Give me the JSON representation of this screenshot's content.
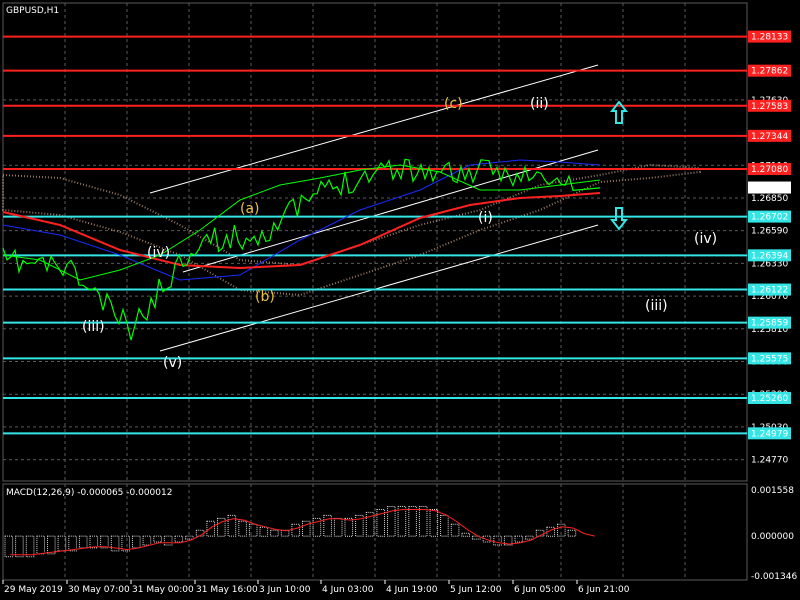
{
  "symbol": "GBPUSD,H1",
  "colors": {
    "background": "#000000",
    "grid": "#5a5a5a",
    "price_line": "#00ff00",
    "ma_red": "#ff2020",
    "ma_blue": "#1a2cff",
    "ma_green": "#00ff00",
    "resistance": "#ff2020",
    "support": "#34e5e5",
    "channel": "#ffffff",
    "cloud": "#d8a98c",
    "macd_hist": "#d8d8d8",
    "macd_signal": "#ff2020",
    "wave_white": "#ffffff",
    "wave_yellow": "#e8c040",
    "arrow": "#34e5e5"
  },
  "resistance_levels": [
    "1.28133",
    "1.27862",
    "1.27583",
    "1.27344",
    "1.27080"
  ],
  "support_levels": [
    "1.26702",
    "1.26394",
    "1.26122",
    "1.25859",
    "1.25575",
    "1.25260",
    "1.24979"
  ],
  "price_axis_ticks": [
    "1.27630",
    "1.27110",
    "1.26850",
    "1.26590",
    "1.26330",
    "1.26070",
    "1.25810",
    "1.25550",
    "1.25290",
    "1.25030",
    "1.24770"
  ],
  "current_price": "1.26933",
  "time_axis_labels": [
    "29 May 2019",
    "30 May 07:00",
    "31 May 00:00",
    "31 May 16:00",
    "3 Jun 10:00",
    "4 Jun 03:00",
    "4 Jun 19:00",
    "5 Jun 12:00",
    "6 Jun 05:00",
    "6 Jun 21:00"
  ],
  "wave_labels": {
    "c": "(c)",
    "ii_top": "(ii)",
    "a": "(a)",
    "b": "(b)",
    "iv_left": "(iv)",
    "v": "(v)",
    "iii_left": "(iii)",
    "i": "(i)",
    "iv_right": "(iv)",
    "iii_right": "(iii)"
  },
  "macd": {
    "title": "MACD(12,26,9) -0.000065 -0.000012",
    "axis_ticks": [
      "0.001558",
      "0.000000",
      "-0.001346"
    ]
  },
  "chart_data": [
    {
      "type": "line",
      "title": "GBPUSD,H1",
      "xlabel": "",
      "ylabel": "",
      "ylim": [
        1.246,
        1.284
      ],
      "x": [
        "29 May 2019",
        "30 May 07:00",
        "31 May 00:00",
        "31 May 16:00",
        "3 Jun 10:00",
        "4 Jun 03:00",
        "4 Jun 19:00",
        "5 Jun 12:00",
        "6 Jun 05:00",
        "6 Jun 21:00"
      ],
      "series": [
        {
          "values": [
            1.2635,
            1.263,
            1.258,
            1.265,
            1.2655,
            1.269,
            1.271,
            1.2705,
            1.2705,
            1.2693
          ]
        }
      ],
      "horizontal_lines": [
        1.28133,
        1.27862,
        1.27583,
        1.27344,
        1.2708,
        1.26702,
        1.26394,
        1.26122,
        1.25859,
        1.25575,
        1.2526,
        1.24979
      ],
      "grid": true,
      "legend": "none"
    },
    {
      "type": "bar",
      "title": "MACD(12,26,9) -0.000065 -0.000012",
      "ylim": [
        -0.001346,
        0.001558
      ],
      "values": [
        -0.0007,
        -0.0007,
        -0.0007,
        -0.0006,
        -0.0006,
        -0.0005,
        -0.0005,
        -0.0004,
        -0.0004,
        -0.0004,
        -0.0005,
        -0.0005,
        -0.0004,
        -0.0003,
        -0.0002,
        -0.0003,
        -0.0002,
        -0.0001,
        0.0002,
        0.0005,
        0.0006,
        0.0007,
        0.0005,
        0.0004,
        0.0003,
        0.0002,
        0.0002,
        0.0004,
        0.0005,
        0.0006,
        0.0007,
        0.0006,
        0.0006,
        0.0007,
        0.0008,
        0.0009,
        0.001,
        0.001,
        0.001,
        0.001,
        0.0009,
        0.0007,
        0.0004,
        0.0001,
        -0.0001,
        -0.0002,
        -0.0003,
        -0.0003,
        -0.0002,
        -0.0001,
        0.0002,
        0.0003,
        0.0004,
        0.0002,
        0.0,
        0.0
      ]
    }
  ]
}
